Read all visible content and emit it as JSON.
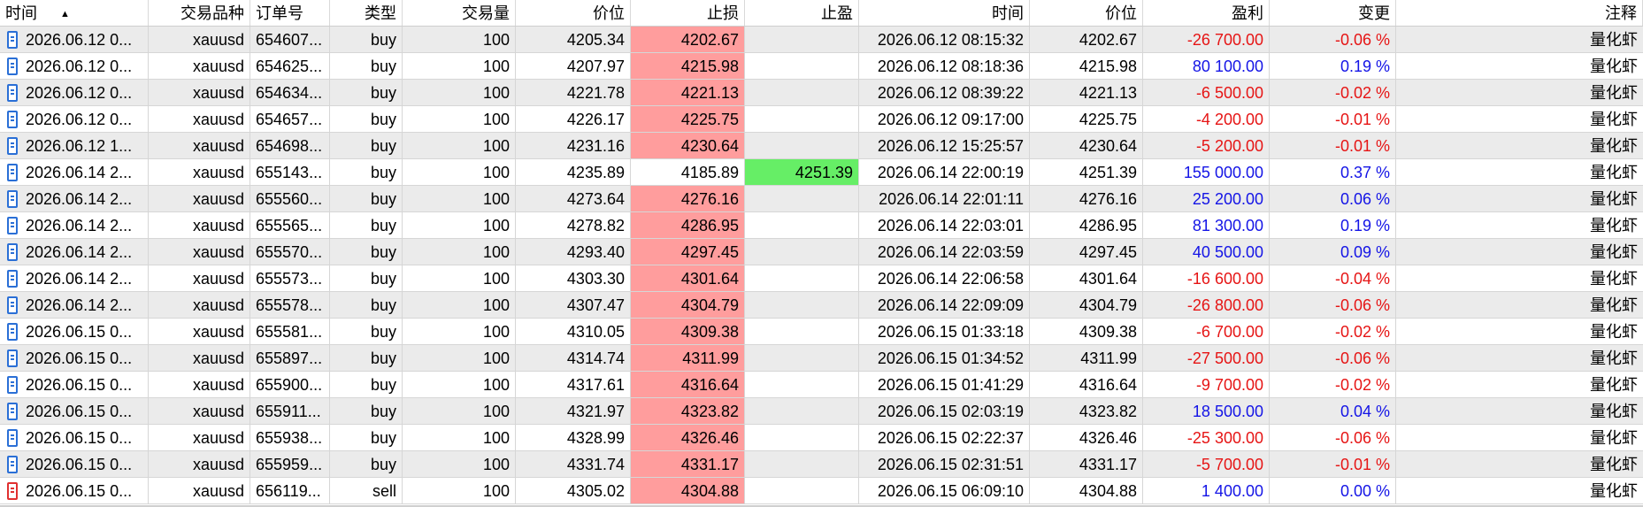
{
  "headers": [
    "时间",
    "交易品种",
    "订单号",
    "类型",
    "交易量",
    "价位",
    "止损",
    "止盈",
    "时间",
    "价位",
    "盈利",
    "变更",
    "注释"
  ],
  "sort_indicator": "▲",
  "colors": {
    "sl_bg": "#ff9d9d",
    "tp_bg": "#66ee66",
    "positive": "#1414e6",
    "negative": "#e61414",
    "row_alt": "#ebebeb"
  },
  "rows": [
    {
      "icon": "buy-doc-icon",
      "open_time": "2026.06.12 0...",
      "symbol": "xauusd",
      "order": "654607...",
      "type": "buy",
      "volume": "100",
      "price": "4205.34",
      "sl": "4202.67",
      "tp": "",
      "close_time": "2026.06.12 08:15:32",
      "close_price": "4202.67",
      "profit": "-26 700.00",
      "change": "-0.06 %",
      "comment": "量化虾"
    },
    {
      "icon": "buy-doc-icon",
      "open_time": "2026.06.12 0...",
      "symbol": "xauusd",
      "order": "654625...",
      "type": "buy",
      "volume": "100",
      "price": "4207.97",
      "sl": "4215.98",
      "tp": "",
      "close_time": "2026.06.12 08:18:36",
      "close_price": "4215.98",
      "profit": "80 100.00",
      "change": "0.19 %",
      "comment": "量化虾"
    },
    {
      "icon": "buy-doc-icon",
      "open_time": "2026.06.12 0...",
      "symbol": "xauusd",
      "order": "654634...",
      "type": "buy",
      "volume": "100",
      "price": "4221.78",
      "sl": "4221.13",
      "tp": "",
      "close_time": "2026.06.12 08:39:22",
      "close_price": "4221.13",
      "profit": "-6 500.00",
      "change": "-0.02 %",
      "comment": "量化虾"
    },
    {
      "icon": "buy-doc-icon",
      "open_time": "2026.06.12 0...",
      "symbol": "xauusd",
      "order": "654657...",
      "type": "buy",
      "volume": "100",
      "price": "4226.17",
      "sl": "4225.75",
      "tp": "",
      "close_time": "2026.06.12 09:17:00",
      "close_price": "4225.75",
      "profit": "-4 200.00",
      "change": "-0.01 %",
      "comment": "量化虾"
    },
    {
      "icon": "buy-doc-icon",
      "open_time": "2026.06.12 1...",
      "symbol": "xauusd",
      "order": "654698...",
      "type": "buy",
      "volume": "100",
      "price": "4231.16",
      "sl": "4230.64",
      "tp": "",
      "close_time": "2026.06.12 15:25:57",
      "close_price": "4230.64",
      "profit": "-5 200.00",
      "change": "-0.01 %",
      "comment": "量化虾"
    },
    {
      "icon": "buy-doc-icon",
      "open_time": "2026.06.14 2...",
      "symbol": "xauusd",
      "order": "655143...",
      "type": "buy",
      "volume": "100",
      "price": "4235.89",
      "sl": "4185.89",
      "tp": "4251.39",
      "close_time": "2026.06.14 22:00:19",
      "close_price": "4251.39",
      "profit": "155 000.00",
      "change": "0.37 %",
      "comment": "量化虾"
    },
    {
      "icon": "buy-doc-icon",
      "open_time": "2026.06.14 2...",
      "symbol": "xauusd",
      "order": "655560...",
      "type": "buy",
      "volume": "100",
      "price": "4273.64",
      "sl": "4276.16",
      "tp": "",
      "close_time": "2026.06.14 22:01:11",
      "close_price": "4276.16",
      "profit": "25 200.00",
      "change": "0.06 %",
      "comment": "量化虾"
    },
    {
      "icon": "buy-doc-icon",
      "open_time": "2026.06.14 2...",
      "symbol": "xauusd",
      "order": "655565...",
      "type": "buy",
      "volume": "100",
      "price": "4278.82",
      "sl": "4286.95",
      "tp": "",
      "close_time": "2026.06.14 22:03:01",
      "close_price": "4286.95",
      "profit": "81 300.00",
      "change": "0.19 %",
      "comment": "量化虾"
    },
    {
      "icon": "buy-doc-icon",
      "open_time": "2026.06.14 2...",
      "symbol": "xauusd",
      "order": "655570...",
      "type": "buy",
      "volume": "100",
      "price": "4293.40",
      "sl": "4297.45",
      "tp": "",
      "close_time": "2026.06.14 22:03:59",
      "close_price": "4297.45",
      "profit": "40 500.00",
      "change": "0.09 %",
      "comment": "量化虾"
    },
    {
      "icon": "buy-doc-icon",
      "open_time": "2026.06.14 2...",
      "symbol": "xauusd",
      "order": "655573...",
      "type": "buy",
      "volume": "100",
      "price": "4303.30",
      "sl": "4301.64",
      "tp": "",
      "close_time": "2026.06.14 22:06:58",
      "close_price": "4301.64",
      "profit": "-16 600.00",
      "change": "-0.04 %",
      "comment": "量化虾"
    },
    {
      "icon": "buy-doc-icon",
      "open_time": "2026.06.14 2...",
      "symbol": "xauusd",
      "order": "655578...",
      "type": "buy",
      "volume": "100",
      "price": "4307.47",
      "sl": "4304.79",
      "tp": "",
      "close_time": "2026.06.14 22:09:09",
      "close_price": "4304.79",
      "profit": "-26 800.00",
      "change": "-0.06 %",
      "comment": "量化虾"
    },
    {
      "icon": "buy-doc-icon",
      "open_time": "2026.06.15 0...",
      "symbol": "xauusd",
      "order": "655581...",
      "type": "buy",
      "volume": "100",
      "price": "4310.05",
      "sl": "4309.38",
      "tp": "",
      "close_time": "2026.06.15 01:33:18",
      "close_price": "4309.38",
      "profit": "-6 700.00",
      "change": "-0.02 %",
      "comment": "量化虾"
    },
    {
      "icon": "buy-doc-icon",
      "open_time": "2026.06.15 0...",
      "symbol": "xauusd",
      "order": "655897...",
      "type": "buy",
      "volume": "100",
      "price": "4314.74",
      "sl": "4311.99",
      "tp": "",
      "close_time": "2026.06.15 01:34:52",
      "close_price": "4311.99",
      "profit": "-27 500.00",
      "change": "-0.06 %",
      "comment": "量化虾"
    },
    {
      "icon": "buy-doc-icon",
      "open_time": "2026.06.15 0...",
      "symbol": "xauusd",
      "order": "655900...",
      "type": "buy",
      "volume": "100",
      "price": "4317.61",
      "sl": "4316.64",
      "tp": "",
      "close_time": "2026.06.15 01:41:29",
      "close_price": "4316.64",
      "profit": "-9 700.00",
      "change": "-0.02 %",
      "comment": "量化虾"
    },
    {
      "icon": "buy-doc-icon",
      "open_time": "2026.06.15 0...",
      "symbol": "xauusd",
      "order": "655911...",
      "type": "buy",
      "volume": "100",
      "price": "4321.97",
      "sl": "4323.82",
      "tp": "",
      "close_time": "2026.06.15 02:03:19",
      "close_price": "4323.82",
      "profit": "18 500.00",
      "change": "0.04 %",
      "comment": "量化虾"
    },
    {
      "icon": "buy-doc-icon",
      "open_time": "2026.06.15 0...",
      "symbol": "xauusd",
      "order": "655938...",
      "type": "buy",
      "volume": "100",
      "price": "4328.99",
      "sl": "4326.46",
      "tp": "",
      "close_time": "2026.06.15 02:22:37",
      "close_price": "4326.46",
      "profit": "-25 300.00",
      "change": "-0.06 %",
      "comment": "量化虾"
    },
    {
      "icon": "buy-doc-icon",
      "open_time": "2026.06.15 0...",
      "symbol": "xauusd",
      "order": "655959...",
      "type": "buy",
      "volume": "100",
      "price": "4331.74",
      "sl": "4331.17",
      "tp": "",
      "close_time": "2026.06.15 02:31:51",
      "close_price": "4331.17",
      "profit": "-5 700.00",
      "change": "-0.01 %",
      "comment": "量化虾"
    },
    {
      "icon": "sell-doc-icon",
      "open_time": "2026.06.15 0...",
      "symbol": "xauusd",
      "order": "656119...",
      "type": "sell",
      "volume": "100",
      "price": "4305.02",
      "sl": "4304.88",
      "tp": "",
      "close_time": "2026.06.15 06:09:10",
      "close_price": "4304.88",
      "profit": "1 400.00",
      "change": "0.00 %",
      "comment": "量化虾"
    }
  ]
}
